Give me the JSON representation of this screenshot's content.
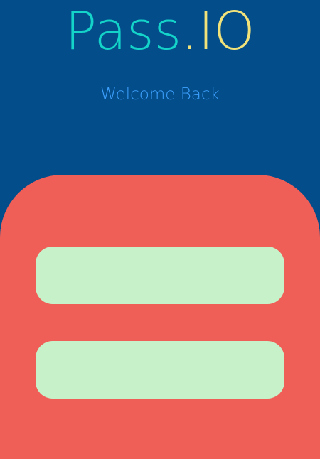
{
  "logo": {
    "part_a": "Pass",
    "part_b": ".IO"
  },
  "subtitle": "Welcome Back",
  "form": {
    "field_1": {
      "value": "",
      "placeholder": ""
    },
    "field_2": {
      "value": "",
      "placeholder": ""
    }
  },
  "colors": {
    "background": "#034d8b",
    "logo_primary": "#14d3c8",
    "logo_accent": "#f2e27a",
    "subtitle": "#3ea2ff",
    "panel": "#f05f57",
    "field": "#c7f1c9"
  }
}
